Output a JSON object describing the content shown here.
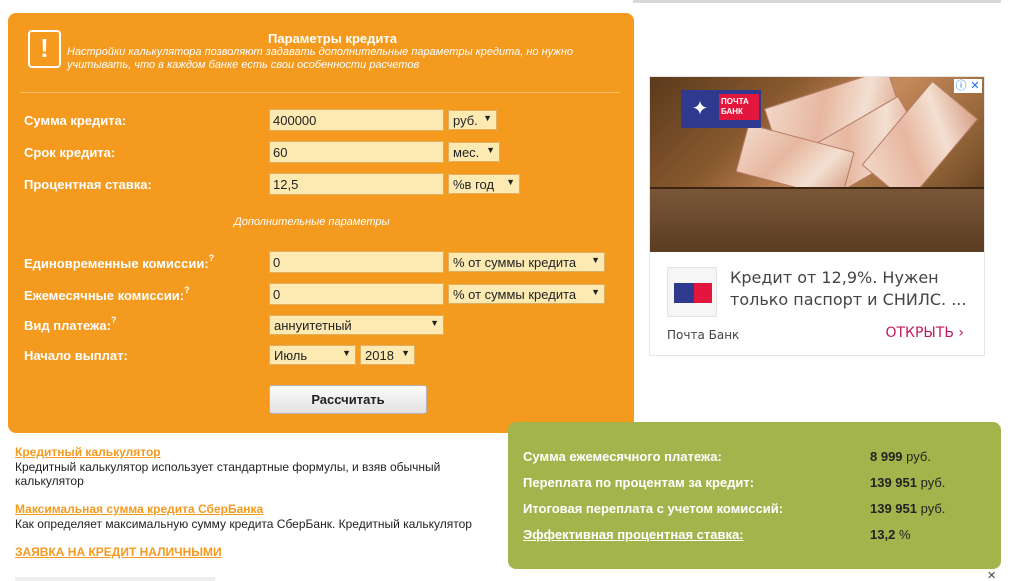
{
  "calculator": {
    "title": "Параметры кредита",
    "warning_icon": "!",
    "note": "Настройки калькулятора позволяют задавать дополнительные параметры кредита, но нужно учитывать, что в каждом банке есть свои особенности расчетов",
    "fields": {
      "amount": {
        "label": "Сумма кредита:",
        "value": "400000",
        "unit": "руб."
      },
      "term": {
        "label": "Срок кредита:",
        "value": "60",
        "unit": "мес."
      },
      "rate": {
        "label": "Процентная ставка:",
        "value": "12,5",
        "unit": "%в год"
      }
    },
    "extra_title": "Дополнительные параметры",
    "question_mark": "?",
    "one_time_fee": {
      "label": "Единовременные комиссии:",
      "value": "0",
      "unit": "% от суммы кредита"
    },
    "monthly_fee": {
      "label": "Ежемесячные комиссии:",
      "value": "0",
      "unit": "% от суммы кредита"
    },
    "payment_type": {
      "label": "Вид платежа:",
      "value": "аннуитетный"
    },
    "start": {
      "label": "Начало выплат:",
      "month": "Июль",
      "year": "2018"
    },
    "button": "Рассчитать",
    "dropdown_arrow": "▼"
  },
  "links": {
    "item1": {
      "title": "Кредитный калькулятор",
      "text": "Кредитный калькулятор использует стандартные формулы, и взяв обычный калькулятор"
    },
    "item2": {
      "title": "Максимальная сумма кредита СберБанка",
      "text": "Как определяет максимальную сумму кредита СберБанк. Кредитный калькулятор"
    },
    "item3": {
      "title": "ЗАЯВКА НА КРЕДИТ НАЛИЧНЫМИ"
    }
  },
  "results": {
    "monthly": {
      "label": "Сумма ежемесячного платежа:",
      "value": "8 999",
      "unit": "руб."
    },
    "overpay": {
      "label": "Переплата по процентам за кредит:",
      "value": "139 951",
      "unit": "руб."
    },
    "total": {
      "label": "Итоговая переплата с учетом комиссий:",
      "value": "139 951",
      "unit": "руб."
    },
    "effective": {
      "label": "Эффективная процентная ставка:",
      "value": "13,2",
      "unit": "%"
    }
  },
  "ad": {
    "logo_text": "ПОЧТА БАНК",
    "info_icon": "ⓘ",
    "close_icon": "✕",
    "headline": "Кредит от 12,9%. Нужен только паспорт и СНИЛС. ...",
    "brand": "Почта Банк",
    "cta": "ОТКРЫТЬ",
    "cta_arrow": "›"
  },
  "page_close": "✕",
  "colors": {
    "orange": "#f39a1f",
    "green": "#a4b44d",
    "input_bg": "#fdeab2"
  }
}
